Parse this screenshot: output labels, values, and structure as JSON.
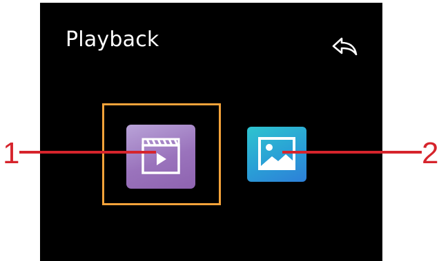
{
  "header": {
    "title": "Playback",
    "back_icon": "reply-arrow-icon"
  },
  "tiles": [
    {
      "name": "video-playback",
      "icon": "video-clapper-play-icon",
      "selected": true
    },
    {
      "name": "photo-playback",
      "icon": "picture-icon",
      "selected": false
    }
  ],
  "callouts": {
    "label_1": "1",
    "label_2": "2"
  },
  "colors": {
    "screen_bg": "#000000",
    "selection": "#f5a33a",
    "callout": "#d6242c",
    "video_tile": "#9a73bc",
    "photo_tile": "#2a9fd6"
  }
}
